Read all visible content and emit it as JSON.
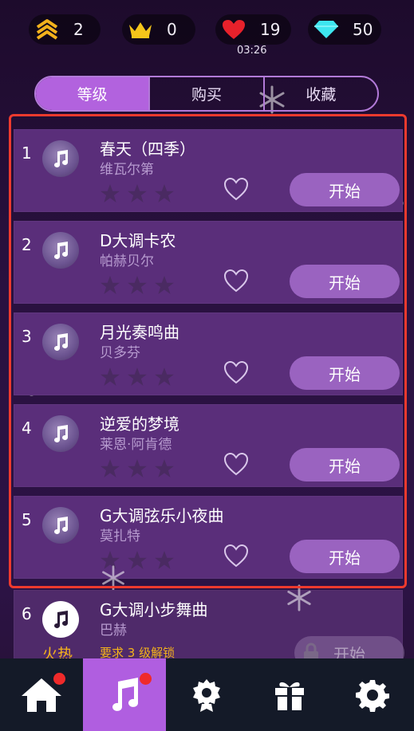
{
  "stats": {
    "level": "2",
    "crowns": "0",
    "lives": "19",
    "gems": "50",
    "timer": "03:26"
  },
  "tabs": [
    "等级",
    "购买",
    "收藏"
  ],
  "songs": [
    {
      "index": "1",
      "title": "春天（四季）",
      "artist": "维瓦尔第",
      "start": "开始"
    },
    {
      "index": "2",
      "title": "D大调卡农",
      "artist": "帕赫贝尔",
      "start": "开始"
    },
    {
      "index": "3",
      "title": "月光奏鸣曲",
      "artist": "贝多芬",
      "start": "开始"
    },
    {
      "index": "4",
      "title": "逆爱的梦境",
      "artist": "莱恩·阿肯德",
      "start": "开始"
    },
    {
      "index": "5",
      "title": "G大调弦乐小夜曲",
      "artist": "莫扎特",
      "start": "开始"
    }
  ],
  "locked_song": {
    "index": "6",
    "title": "G大调小步舞曲",
    "artist": "巴赫",
    "hot": "火热",
    "requirement": "要求 3 级解锁",
    "start": "开始"
  },
  "colors": {
    "accent": "#b05ee0",
    "card": "#5a2e7a",
    "button": "#9a63c0",
    "highlight_frame": "#ee3a2e",
    "gold": "#f3b21c",
    "heart_red": "#e8212b",
    "gem_cyan": "#3ee6f0"
  },
  "icons": [
    "rank-chevron-icon",
    "crown-icon",
    "heart-icon",
    "diamond-icon",
    "music-note-icon",
    "star-icon",
    "heart-outline-icon",
    "lock-icon",
    "home-icon",
    "music-icon",
    "badge-icon",
    "gift-icon",
    "gear-icon"
  ]
}
